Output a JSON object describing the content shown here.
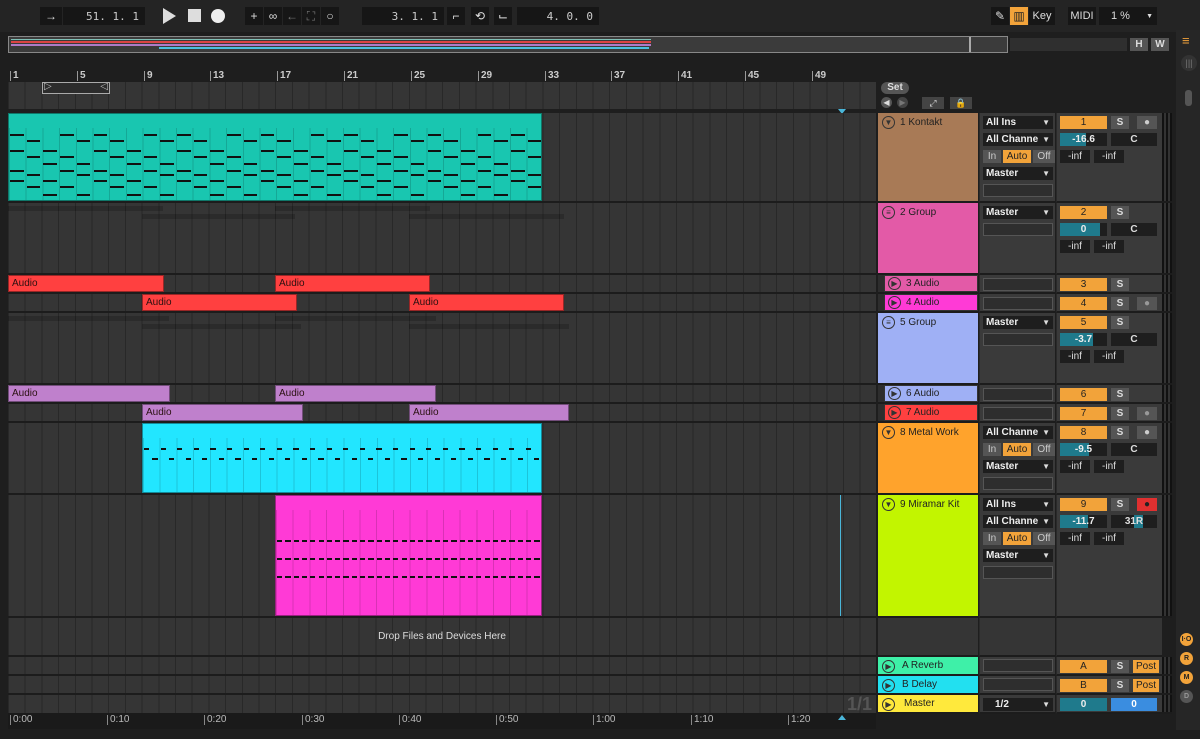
{
  "transport": {
    "punch_icon": "punch-in-arrow-icon",
    "arrangement_position": "51.  1.  1",
    "play_icon": "play-icon",
    "stop_icon": "stop-icon",
    "record_icon": "record-icon",
    "overdub_icon": "plus-icon",
    "automation_arm_icon": "link-icon",
    "back_to_arrangement_icon": "arrow-left-icon",
    "capture_icon": "capture-icon",
    "session_record_icon": "circle-icon",
    "loop_start": "3.  1.  1",
    "punch_in_icon": "punch-in-icon",
    "loop_icon": "loop-icon",
    "punch_out_icon": "punch-out-icon",
    "loop_length": "4.  0.  0"
  },
  "topright": {
    "draw_icon": "pencil-icon",
    "keyboard_icon": "piano-keys-icon",
    "key_label": "Key",
    "midi_label": "MIDI",
    "cpu_label": "1 %"
  },
  "overview_buttons": {
    "h": "H",
    "w": "W"
  },
  "ruler": {
    "bars": [
      "1",
      "5",
      "9",
      "13",
      "17",
      "21",
      "25",
      "29",
      "33",
      "37",
      "41",
      "45",
      "49"
    ]
  },
  "timeline": {
    "ticks": [
      "0:00",
      "0:10",
      "0:20",
      "0:30",
      "0:40",
      "0:50",
      "1:00",
      "1:10",
      "1:20"
    ]
  },
  "set_controls": {
    "set_label": "Set"
  },
  "drop_text": "Drop Files and Devices Here",
  "page_indicator": "1/1",
  "tracks": [
    {
      "name": "1 Kontakt",
      "color": "#a87a56",
      "type": "midi",
      "num": "1",
      "input": "All Ins",
      "channel": "All Channe",
      "monitor": [
        "In",
        "Auto",
        "Off"
      ],
      "output": "Master",
      "volume": "-16.6",
      "pan": "C",
      "peaks": [
        "-inf",
        "-inf"
      ],
      "solo": "S"
    },
    {
      "name": "2 Group",
      "color": "#e35aa7",
      "type": "group",
      "num": "2",
      "output": "Master",
      "volume": "0",
      "pan": "C",
      "peaks": [
        "-inf",
        "-inf"
      ],
      "solo": "S"
    },
    {
      "name": "3 Audio",
      "color": "#e35aa7",
      "type": "audio",
      "num": "3",
      "solo": "S"
    },
    {
      "name": "4 Audio",
      "color": "#ff3ad6",
      "type": "audio",
      "num": "4",
      "solo": "S"
    },
    {
      "name": "5 Group",
      "color": "#9fb0f5",
      "type": "group",
      "num": "5",
      "output": "Master",
      "volume": "-3.7",
      "pan": "C",
      "peaks": [
        "-inf",
        "-inf"
      ],
      "solo": "S"
    },
    {
      "name": "6 Audio",
      "color": "#9fb0f5",
      "type": "audio",
      "num": "6",
      "solo": "S"
    },
    {
      "name": "7 Audio",
      "color": "#ff4040",
      "type": "audio",
      "num": "7",
      "solo": "S"
    },
    {
      "name": "8 Metal Work",
      "color": "#ffa32c",
      "type": "midi",
      "num": "8",
      "channel": "All Channe",
      "monitor": [
        "In",
        "Auto",
        "Off"
      ],
      "output": "Master",
      "volume": "-9.5",
      "pan": "C",
      "peaks": [
        "-inf",
        "-inf"
      ],
      "solo": "S"
    },
    {
      "name": "9 Miramar Kit",
      "color": "#c2f500",
      "type": "midi",
      "num": "9",
      "input": "All Ins",
      "channel": "All Channe",
      "monitor": [
        "In",
        "Auto",
        "Off"
      ],
      "output": "Master",
      "volume": "-11.7",
      "pan": "31R",
      "peaks": [
        "-inf",
        "-inf"
      ],
      "solo": "S"
    }
  ],
  "returns": [
    {
      "name": "A Reverb",
      "color": "#3ef0a8",
      "num": "A",
      "solo": "S",
      "post": "Post"
    },
    {
      "name": "B Delay",
      "color": "#22e0f0",
      "num": "B",
      "solo": "S",
      "post": "Post"
    }
  ],
  "master": {
    "name": "Master",
    "color": "#ffe93c",
    "output": "1/2",
    "volume": "0",
    "cue": "0"
  },
  "clips": {
    "audio_label": "Audio"
  },
  "side_buttons": [
    "I·O",
    "R",
    "M",
    "D"
  ],
  "colors": {
    "accent": "#f2a33a",
    "volume_fill": "#1f7a8c",
    "arm_red": "#e03030"
  }
}
